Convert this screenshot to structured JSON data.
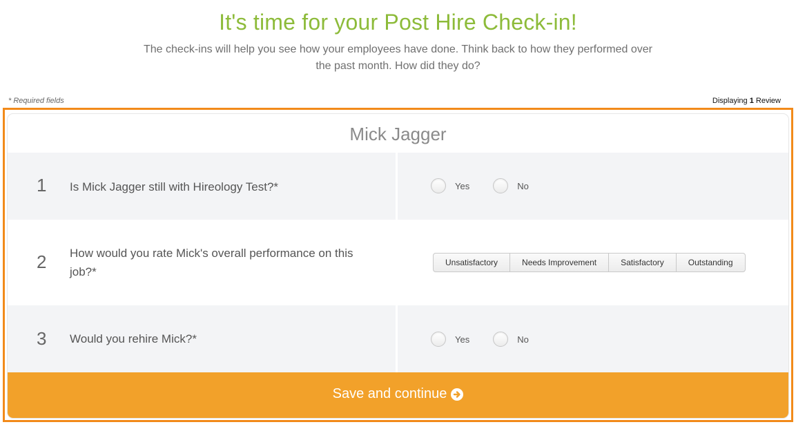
{
  "header": {
    "title": "It's time for your Post Hire Check-in!",
    "subtitle": "The check-ins will help you see how your employees have done. Think back to how they performed over the past month. How did they do?"
  },
  "meta": {
    "required_note": "* Required fields",
    "displaying_prefix": "Displaying",
    "displaying_count": "1",
    "displaying_suffix": "Review"
  },
  "review": {
    "name": "Mick Jagger",
    "questions": [
      {
        "number": "1",
        "text": "Is Mick Jagger still with Hireology Test?*",
        "type": "yes-no",
        "options": [
          "Yes",
          "No"
        ]
      },
      {
        "number": "2",
        "text": "How would you rate Mick's overall performance on this job?*",
        "type": "rating",
        "options": [
          "Unsatisfactory",
          "Needs Improvement",
          "Satisfactory",
          "Outstanding"
        ]
      },
      {
        "number": "3",
        "text": "Would you rehire Mick?*",
        "type": "yes-no",
        "options": [
          "Yes",
          "No"
        ]
      }
    ],
    "save_label": "Save and continue"
  },
  "icons": {
    "save_icon": "arrow-circle-right-icon"
  },
  "colors": {
    "title_green": "#8dbb3a",
    "accent_orange": "#f2a12a",
    "frame_orange": "#f28a1a",
    "row_gray": "#f3f4f6"
  }
}
